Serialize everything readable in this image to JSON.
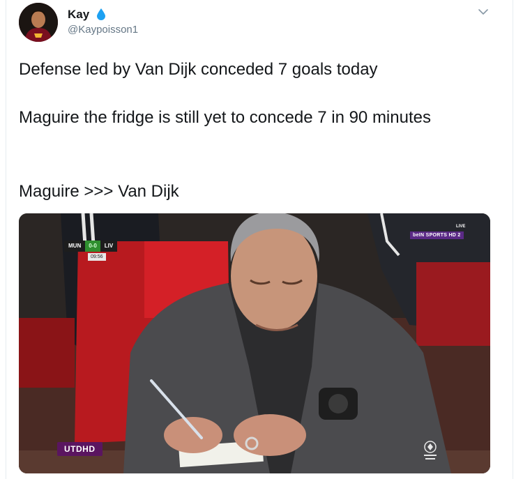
{
  "tweet": {
    "display_name": "Kay",
    "handle": "@Kaypoisson1",
    "lines": [
      "Defense led by Van Dijk conceded 7 goals today",
      "Maguire the fridge is still yet to concede 7 in 90 minutes",
      "Maguire >>> Van Dijk"
    ]
  },
  "icons": {
    "name_badge": "water-drop-icon",
    "menu": "chevron-down-icon",
    "league": "premier-league-icon"
  },
  "media": {
    "scoreboard": {
      "home": "MUN",
      "score": "0-0",
      "away": "LIV",
      "clock": "09:56"
    },
    "broadcaster": "beIN SPORTS HD 2",
    "live_label": "LIVE",
    "watermark": "UTDHD"
  },
  "colors": {
    "text": "#14171a",
    "secondary": "#657786",
    "drop": "#1da1f2",
    "watermark_bg": "#5a1560"
  }
}
